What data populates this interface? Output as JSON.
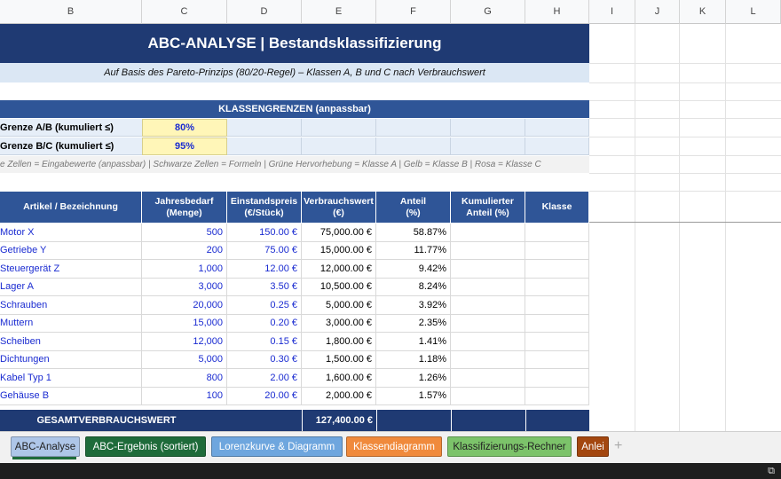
{
  "column_headers": [
    "B",
    "C",
    "D",
    "E",
    "F",
    "G",
    "H",
    "I",
    "J",
    "K",
    "L"
  ],
  "title": "ABC-ANALYSE  |  Bestandsklassifizierung",
  "subtitle": "Auf Basis des Pareto-Prinzips (80/20-Regel) – Klassen A, B und C nach Verbrauchswert",
  "klassengrenzen": {
    "header": "KLASSENGRENZEN  (anpassbar)",
    "rows": [
      {
        "label": "Grenze A/B (kumuliert ≤)",
        "value": "80%"
      },
      {
        "label": "Grenze B/C (kumuliert ≤)",
        "value": "95%"
      }
    ]
  },
  "legend": "e Zellen = Eingabewerte (anpassbar)  |  Schwarze Zellen = Formeln  |  Grüne Hervorhebung = Klasse A  |  Gelb = Klasse B  |  Rosa = Klasse C",
  "table": {
    "headers": [
      {
        "line1": "Artikel / Bezeichnung",
        "line2": ""
      },
      {
        "line1": "Jahresbedarf",
        "line2": "(Menge)"
      },
      {
        "line1": "Einstandspreis",
        "line2": "(€/Stück)"
      },
      {
        "line1": "Verbrauchswert",
        "line2": "(€)"
      },
      {
        "line1": "Anteil",
        "line2": "(%)"
      },
      {
        "line1": "Kumulierter",
        "line2": "Anteil (%)"
      },
      {
        "line1": "Klasse",
        "line2": ""
      }
    ],
    "rows": [
      {
        "name": "Motor X",
        "menge": "500",
        "preis": "150.00 €",
        "wert": "75,000.00 €",
        "anteil": "58.87%"
      },
      {
        "name": "Getriebe Y",
        "menge": "200",
        "preis": "75.00 €",
        "wert": "15,000.00 €",
        "anteil": "11.77%"
      },
      {
        "name": "Steuergerät Z",
        "menge": "1,000",
        "preis": "12.00 €",
        "wert": "12,000.00 €",
        "anteil": "9.42%"
      },
      {
        "name": "Lager A",
        "menge": "3,000",
        "preis": "3.50 €",
        "wert": "10,500.00 €",
        "anteil": "8.24%"
      },
      {
        "name": "Schrauben",
        "menge": "20,000",
        "preis": "0.25 €",
        "wert": "5,000.00 €",
        "anteil": "3.92%"
      },
      {
        "name": "Muttern",
        "menge": "15,000",
        "preis": "0.20 €",
        "wert": "3,000.00 €",
        "anteil": "2.35%"
      },
      {
        "name": "Scheiben",
        "menge": "12,000",
        "preis": "0.15 €",
        "wert": "1,800.00 €",
        "anteil": "1.41%"
      },
      {
        "name": "Dichtungen",
        "menge": "5,000",
        "preis": "0.30 €",
        "wert": "1,500.00 €",
        "anteil": "1.18%"
      },
      {
        "name": "Kabel Typ 1",
        "menge": "800",
        "preis": "2.00 €",
        "wert": "1,600.00 €",
        "anteil": "1.26%"
      },
      {
        "name": "Gehäuse B",
        "menge": "100",
        "preis": "20.00 €",
        "wert": "2,000.00 €",
        "anteil": "1.57%"
      }
    ],
    "total_label": "GESAMTVERBRAUCHSWERT",
    "total_value": "127,400.00 €"
  },
  "sheet_tabs": [
    {
      "label": "ABC-Analyse",
      "bg": "#aec6e8",
      "fg": "#222222",
      "active": true
    },
    {
      "label": "ABC-Ergebnis (sortiert)",
      "bg": "#1e6b3a",
      "fg": "#ffffff",
      "active": false
    },
    {
      "label": "Lorenzkurve & Diagramm",
      "bg": "#6ea6de",
      "fg": "#ffffff",
      "active": false
    },
    {
      "label": "Klassendiagramm",
      "bg": "#f08a3c",
      "fg": "#ffffff",
      "active": false
    },
    {
      "label": "Klassifizierungs-Rechner",
      "bg": "#7cc36a",
      "fg": "#222222",
      "active": false
    },
    {
      "label": "Anlei",
      "bg": "#a3470f",
      "fg": "#ffffff",
      "active": false
    }
  ],
  "colors": {
    "title_bg": "#1f3a73",
    "header_bg": "#2f5597",
    "subtitle_bg": "#dbe7f4",
    "input_bg": "#fff6b8",
    "input_text": "#1a2bd1"
  }
}
